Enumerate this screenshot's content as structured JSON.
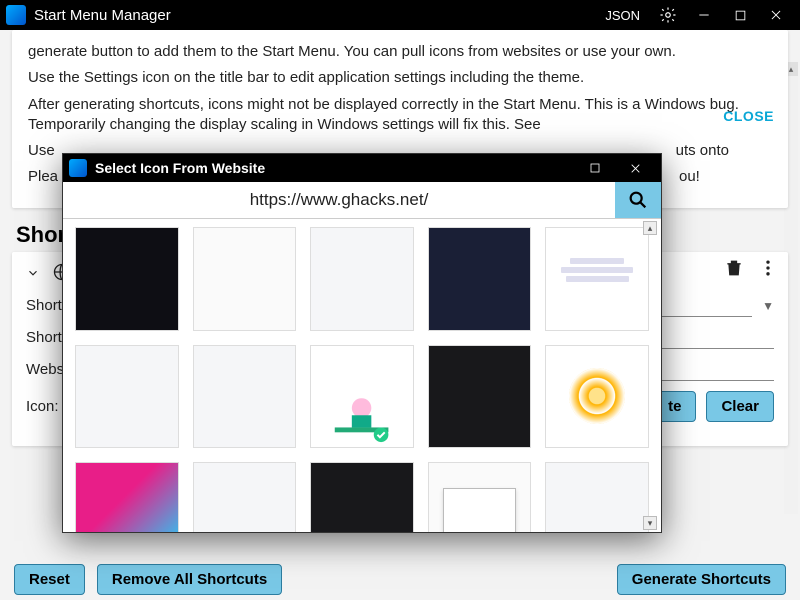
{
  "titlebar": {
    "title": "Start Menu Manager",
    "json": "JSON"
  },
  "instructions": {
    "p1_partial": "generate button to add them to the Start Menu. You can pull icons from websites or use your own.",
    "p2": "Use the Settings icon on the title bar to edit application settings including the theme.",
    "p3": "After generating shortcuts, icons might not be displayed correctly in the Start Menu. This is a Windows bug. Temporarily changing the display scaling in Windows settings will fix this. See",
    "p4_partial": "Use                                                                                                                                                     uts onto",
    "p5_partial": "Plea                                                                                                                                                     ou!",
    "close": "CLOSE"
  },
  "shortcuts": {
    "heading": "Short",
    "labels": {
      "name": "Short",
      "path": "Short",
      "website": "Webs",
      "icon": "Icon:"
    },
    "buttons": {
      "site": "te",
      "clear": "Clear"
    }
  },
  "bottom": {
    "reset": "Reset",
    "remove_all": "Remove All Shortcuts",
    "generate": "Generate Shortcuts"
  },
  "dialog": {
    "title": "Select Icon From Website",
    "url": "https://www.ghacks.net/"
  }
}
